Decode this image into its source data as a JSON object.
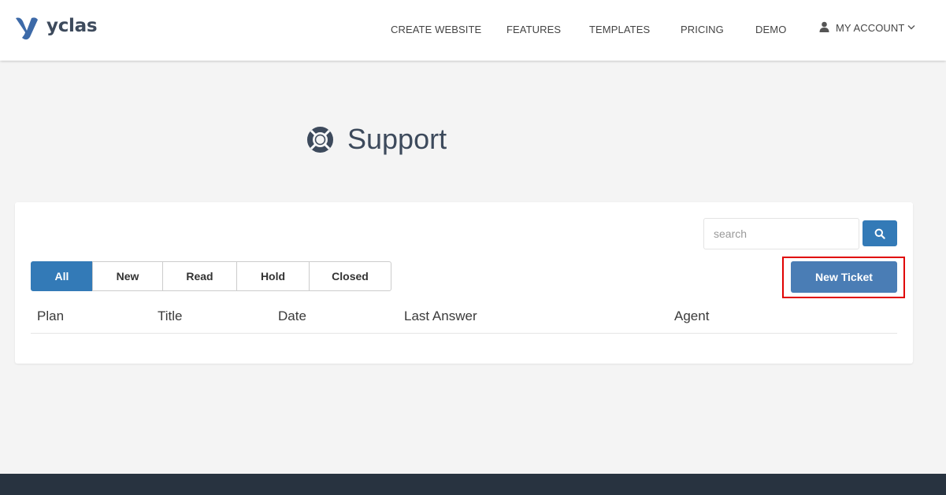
{
  "brand": {
    "name": "yclas",
    "accent": "#3d6aa8"
  },
  "nav": {
    "items": [
      {
        "label": "CREATE WEBSITE"
      },
      {
        "label": "FEATURES"
      },
      {
        "label": "TEMPLATES"
      },
      {
        "label": "PRICING"
      },
      {
        "label": "DEMO"
      }
    ],
    "account_label": "MY ACCOUNT",
    "account_icon": "user-icon",
    "dropdown_icon": "chevron-down-icon"
  },
  "page": {
    "title": "Support",
    "title_icon": "lifebuoy-icon"
  },
  "search": {
    "placeholder": "search",
    "value": "",
    "button_icon": "search-icon",
    "button_color": "#337ab7"
  },
  "filters": {
    "tabs": [
      {
        "label": "All",
        "active": true
      },
      {
        "label": "New",
        "active": false
      },
      {
        "label": "Read",
        "active": false
      },
      {
        "label": "Hold",
        "active": false
      },
      {
        "label": "Closed",
        "active": false
      }
    ],
    "active_color": "#337ab7"
  },
  "actions": {
    "new_ticket_label": "New Ticket",
    "new_ticket_color": "#4a7db5",
    "highlight_color": "#e00000"
  },
  "table": {
    "columns": [
      "Plan",
      "Title",
      "Date",
      "Last Answer",
      "Agent"
    ],
    "rows": []
  },
  "footer": {
    "color": "#283340"
  }
}
